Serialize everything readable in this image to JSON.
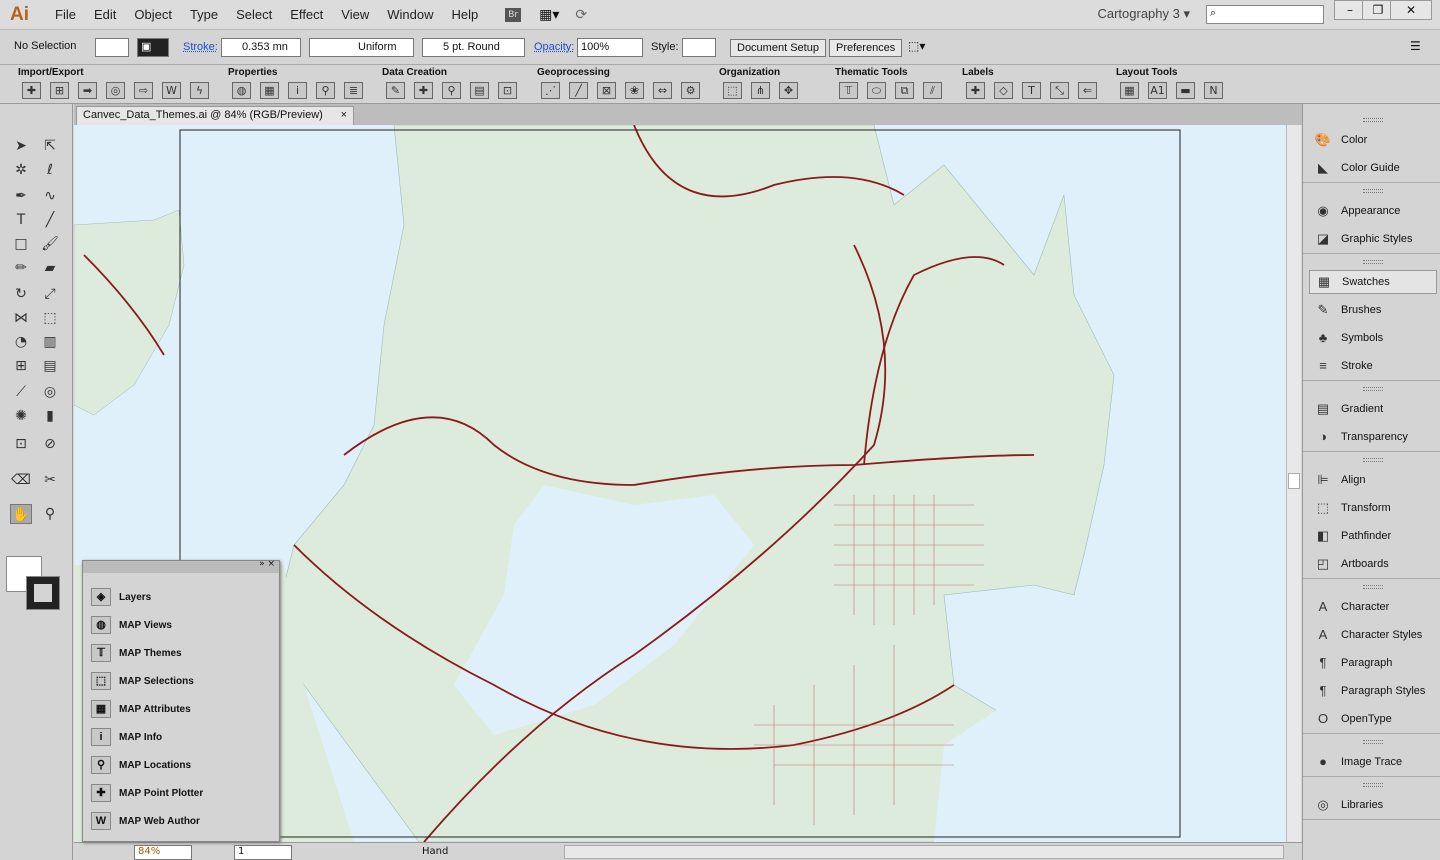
{
  "app": {
    "logo": "Ai",
    "workspace": "Cartography 3",
    "menus": [
      "File",
      "Edit",
      "Object",
      "Type",
      "Select",
      "Effect",
      "View",
      "Window",
      "Help"
    ],
    "bridge": "Br"
  },
  "control": {
    "selection": "No Selection",
    "stroke_label": "Stroke:",
    "stroke_value": "0.353 mn",
    "profile": "Uniform",
    "brush": "5 pt. Round",
    "opacity_label": "Opacity:",
    "opacity_value": "100%",
    "style_label": "Style:",
    "document_setup": "Document Setup",
    "preferences": "Preferences"
  },
  "groups": [
    {
      "title": "Import/Export",
      "icons": [
        "add-data-icon",
        "add-layers-icon",
        "export-icon",
        "georeference-icon",
        "export-file-icon",
        "web-author-icon",
        "lightning-icon"
      ]
    },
    {
      "title": "Properties",
      "icons": [
        "globe-icon",
        "table-icon",
        "info-icon",
        "locations-icon",
        "list-icon"
      ]
    },
    {
      "title": "Data Creation",
      "icons": [
        "create-feature-icon",
        "point-plotter-icon",
        "place-pin-icon",
        "calculator-icon",
        "grid-icon"
      ]
    },
    {
      "title": "Geoprocessing",
      "icons": [
        "simplify-icon",
        "line-icon",
        "clip-icon",
        "merge-icon",
        "resize-icon",
        "settings-icon"
      ]
    },
    {
      "title": "Organization",
      "icons": [
        "selection-icon",
        "split-icon",
        "explode-icon"
      ]
    },
    {
      "title": "Thematic Tools",
      "icons": [
        "themes-icon",
        "ellipse-icon",
        "theme-copy-icon",
        "slash-icon"
      ]
    },
    {
      "title": "Labels",
      "icons": [
        "add-label-icon",
        "tag-icon",
        "label-settings-icon",
        "leader-icon",
        "text-arrow-icon"
      ]
    },
    {
      "title": "Layout Tools",
      "icons": [
        "grid-layout-icon",
        "a1-index-icon",
        "scale-bar-icon",
        "north-arrow-icon"
      ]
    }
  ],
  "document": {
    "tab": "Canvec_Data_Themes.ai @ 84% (RGB/Preview)"
  },
  "status": {
    "zoom": "84%",
    "artboard": "1",
    "tool": "Hand"
  },
  "map_panel": {
    "items": [
      "Layers",
      "MAP Views",
      "MAP Themes",
      "MAP Selections",
      "MAP Attributes",
      "MAP Info",
      "MAP Locations",
      "MAP Point Plotter",
      "MAP Web Author"
    ]
  },
  "right_panel": {
    "groups": [
      [
        "Color",
        "Color Guide"
      ],
      [
        "Appearance",
        "Graphic Styles"
      ],
      [
        "Swatches",
        "Brushes",
        "Symbols",
        "Stroke"
      ],
      [
        "Gradient",
        "Transparency"
      ],
      [
        "Align",
        "Transform",
        "Pathfinder",
        "Artboards"
      ],
      [
        "Character",
        "Character Styles",
        "Paragraph",
        "Paragraph Styles",
        "OpenType"
      ],
      [
        "Image Trace"
      ],
      [
        "Libraries"
      ]
    ],
    "active": "Swatches"
  },
  "colors": {
    "land": "#dcebdc",
    "water": "#e0f0fa",
    "roads": "#8b1a1a",
    "accent": "#1a4fc7"
  }
}
